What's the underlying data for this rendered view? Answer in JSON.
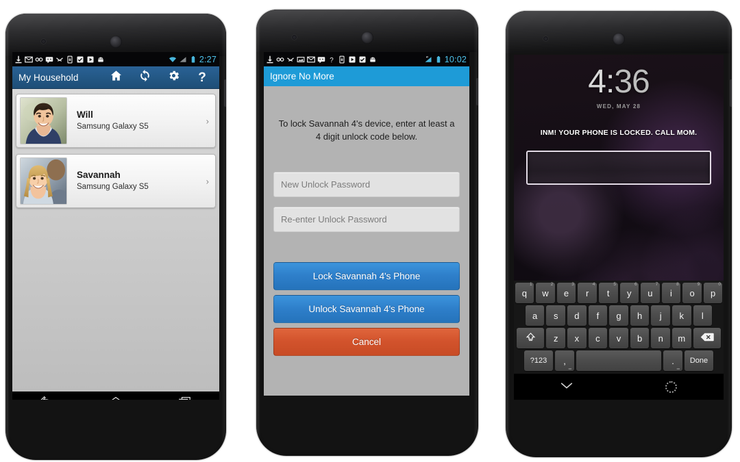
{
  "phone1": {
    "statusbar": {
      "time": "2:27",
      "left_icons": [
        "download-icon",
        "gmail-icon",
        "voicemail-icon",
        "sms-icon",
        "missed-call-icon",
        "sim-icon",
        "checkbox-app-icon",
        "play-store-icon",
        "android-icon"
      ],
      "right_icons": [
        "wifi-icon",
        "signal-icon",
        "battery-icon"
      ]
    },
    "actionbar": {
      "title": "My Household",
      "buttons": [
        {
          "name": "home-icon",
          "label": ""
        },
        {
          "name": "refresh-icon",
          "label": ""
        },
        {
          "name": "gear-icon",
          "label": ""
        },
        {
          "name": "help-icon",
          "label": "?"
        }
      ]
    },
    "members": [
      {
        "name": "Will",
        "device": "Samsung Galaxy S5",
        "avatar": "male-teen-photo"
      },
      {
        "name": "Savannah",
        "device": "Samsung Galaxy S5",
        "avatar": "female-teen-photo"
      }
    ],
    "navbar": [
      "back-icon",
      "home-icon",
      "recents-icon"
    ]
  },
  "phone2": {
    "statusbar": {
      "time": "10:02",
      "left_icons": [
        "download-icon",
        "voicemail-icon",
        "missed-call-icon",
        "image-icon",
        "gmail-icon",
        "sms-icon",
        "help-app-icon",
        "sim-icon",
        "play-store-icon",
        "checkbox-app-icon",
        "android-icon"
      ],
      "right_icons": [
        "signal-icon",
        "battery-icon"
      ]
    },
    "actionbar": {
      "title": "Ignore No More",
      "color": "#1e9bd7"
    },
    "dialog": {
      "message": "To lock Savannah 4's device, enter at least a 4 digit unlock code below.",
      "fields": [
        {
          "name": "new-password-input",
          "placeholder": "New Unlock Password",
          "value": ""
        },
        {
          "name": "confirm-password-input",
          "placeholder": "Re-enter Unlock Password",
          "value": ""
        }
      ],
      "buttons": [
        {
          "name": "lock-phone-button",
          "label": "Lock Savannah 4's Phone",
          "color": "#2e7fca"
        },
        {
          "name": "unlock-phone-button",
          "label": "Unlock Savannah 4's Phone",
          "color": "#2e7fca"
        },
        {
          "name": "cancel-button",
          "label": "Cancel",
          "color": "#d2532c"
        }
      ]
    }
  },
  "phone3": {
    "lockscreen": {
      "hours": "4",
      "colon": ":",
      "minutes": "36",
      "date": "WED, MAY 28",
      "message": "INM! YOUR PHONE IS LOCKED. CALL MOM.",
      "password_value": ""
    },
    "keyboard": {
      "row1": [
        {
          "key": "q",
          "num": "1"
        },
        {
          "key": "w",
          "num": "2"
        },
        {
          "key": "e",
          "num": "3"
        },
        {
          "key": "r",
          "num": "4"
        },
        {
          "key": "t",
          "num": "5"
        },
        {
          "key": "y",
          "num": "6"
        },
        {
          "key": "u",
          "num": "7"
        },
        {
          "key": "i",
          "num": "8"
        },
        {
          "key": "o",
          "num": "9"
        },
        {
          "key": "p",
          "num": "0"
        }
      ],
      "row2": [
        {
          "key": "a"
        },
        {
          "key": "s"
        },
        {
          "key": "d"
        },
        {
          "key": "f"
        },
        {
          "key": "g"
        },
        {
          "key": "h"
        },
        {
          "key": "j"
        },
        {
          "key": "k"
        },
        {
          "key": "l"
        }
      ],
      "row3": [
        {
          "key": "z"
        },
        {
          "key": "x"
        },
        {
          "key": "c"
        },
        {
          "key": "v"
        },
        {
          "key": "b"
        },
        {
          "key": "n"
        },
        {
          "key": "m"
        }
      ],
      "shift_label": "",
      "delete_label": "",
      "symbols_label": "?123",
      "comma_label": ",",
      "space_label": "",
      "period_label": ".",
      "done_label": "Done"
    },
    "navbar": [
      "hide-keyboard-icon",
      "home-icon"
    ]
  }
}
